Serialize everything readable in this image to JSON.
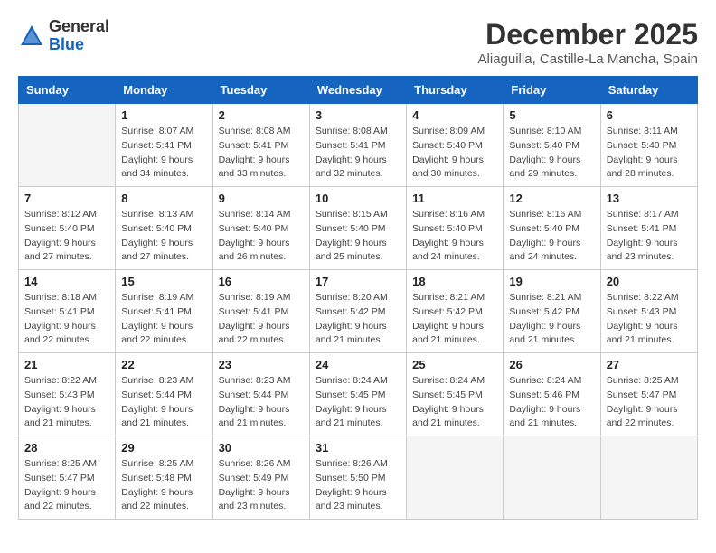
{
  "header": {
    "logo_general": "General",
    "logo_blue": "Blue",
    "month_title": "December 2025",
    "location": "Aliaguilla, Castille-La Mancha, Spain"
  },
  "weekdays": [
    "Sunday",
    "Monday",
    "Tuesday",
    "Wednesday",
    "Thursday",
    "Friday",
    "Saturday"
  ],
  "weeks": [
    [
      {
        "day": "",
        "empty": true
      },
      {
        "day": "1",
        "sunrise": "8:07 AM",
        "sunset": "5:41 PM",
        "daylight": "9 hours and 34 minutes."
      },
      {
        "day": "2",
        "sunrise": "8:08 AM",
        "sunset": "5:41 PM",
        "daylight": "9 hours and 33 minutes."
      },
      {
        "day": "3",
        "sunrise": "8:08 AM",
        "sunset": "5:41 PM",
        "daylight": "9 hours and 32 minutes."
      },
      {
        "day": "4",
        "sunrise": "8:09 AM",
        "sunset": "5:40 PM",
        "daylight": "9 hours and 30 minutes."
      },
      {
        "day": "5",
        "sunrise": "8:10 AM",
        "sunset": "5:40 PM",
        "daylight": "9 hours and 29 minutes."
      },
      {
        "day": "6",
        "sunrise": "8:11 AM",
        "sunset": "5:40 PM",
        "daylight": "9 hours and 28 minutes."
      }
    ],
    [
      {
        "day": "7",
        "sunrise": "8:12 AM",
        "sunset": "5:40 PM",
        "daylight": "9 hours and 27 minutes."
      },
      {
        "day": "8",
        "sunrise": "8:13 AM",
        "sunset": "5:40 PM",
        "daylight": "9 hours and 27 minutes."
      },
      {
        "day": "9",
        "sunrise": "8:14 AM",
        "sunset": "5:40 PM",
        "daylight": "9 hours and 26 minutes."
      },
      {
        "day": "10",
        "sunrise": "8:15 AM",
        "sunset": "5:40 PM",
        "daylight": "9 hours and 25 minutes."
      },
      {
        "day": "11",
        "sunrise": "8:16 AM",
        "sunset": "5:40 PM",
        "daylight": "9 hours and 24 minutes."
      },
      {
        "day": "12",
        "sunrise": "8:16 AM",
        "sunset": "5:40 PM",
        "daylight": "9 hours and 24 minutes."
      },
      {
        "day": "13",
        "sunrise": "8:17 AM",
        "sunset": "5:41 PM",
        "daylight": "9 hours and 23 minutes."
      }
    ],
    [
      {
        "day": "14",
        "sunrise": "8:18 AM",
        "sunset": "5:41 PM",
        "daylight": "9 hours and 22 minutes."
      },
      {
        "day": "15",
        "sunrise": "8:19 AM",
        "sunset": "5:41 PM",
        "daylight": "9 hours and 22 minutes."
      },
      {
        "day": "16",
        "sunrise": "8:19 AM",
        "sunset": "5:41 PM",
        "daylight": "9 hours and 22 minutes."
      },
      {
        "day": "17",
        "sunrise": "8:20 AM",
        "sunset": "5:42 PM",
        "daylight": "9 hours and 21 minutes."
      },
      {
        "day": "18",
        "sunrise": "8:21 AM",
        "sunset": "5:42 PM",
        "daylight": "9 hours and 21 minutes."
      },
      {
        "day": "19",
        "sunrise": "8:21 AM",
        "sunset": "5:42 PM",
        "daylight": "9 hours and 21 minutes."
      },
      {
        "day": "20",
        "sunrise": "8:22 AM",
        "sunset": "5:43 PM",
        "daylight": "9 hours and 21 minutes."
      }
    ],
    [
      {
        "day": "21",
        "sunrise": "8:22 AM",
        "sunset": "5:43 PM",
        "daylight": "9 hours and 21 minutes."
      },
      {
        "day": "22",
        "sunrise": "8:23 AM",
        "sunset": "5:44 PM",
        "daylight": "9 hours and 21 minutes."
      },
      {
        "day": "23",
        "sunrise": "8:23 AM",
        "sunset": "5:44 PM",
        "daylight": "9 hours and 21 minutes."
      },
      {
        "day": "24",
        "sunrise": "8:24 AM",
        "sunset": "5:45 PM",
        "daylight": "9 hours and 21 minutes."
      },
      {
        "day": "25",
        "sunrise": "8:24 AM",
        "sunset": "5:45 PM",
        "daylight": "9 hours and 21 minutes."
      },
      {
        "day": "26",
        "sunrise": "8:24 AM",
        "sunset": "5:46 PM",
        "daylight": "9 hours and 21 minutes."
      },
      {
        "day": "27",
        "sunrise": "8:25 AM",
        "sunset": "5:47 PM",
        "daylight": "9 hours and 22 minutes."
      }
    ],
    [
      {
        "day": "28",
        "sunrise": "8:25 AM",
        "sunset": "5:47 PM",
        "daylight": "9 hours and 22 minutes."
      },
      {
        "day": "29",
        "sunrise": "8:25 AM",
        "sunset": "5:48 PM",
        "daylight": "9 hours and 22 minutes."
      },
      {
        "day": "30",
        "sunrise": "8:26 AM",
        "sunset": "5:49 PM",
        "daylight": "9 hours and 23 minutes."
      },
      {
        "day": "31",
        "sunrise": "8:26 AM",
        "sunset": "5:50 PM",
        "daylight": "9 hours and 23 minutes."
      },
      {
        "day": "",
        "empty": true
      },
      {
        "day": "",
        "empty": true
      },
      {
        "day": "",
        "empty": true
      }
    ]
  ]
}
